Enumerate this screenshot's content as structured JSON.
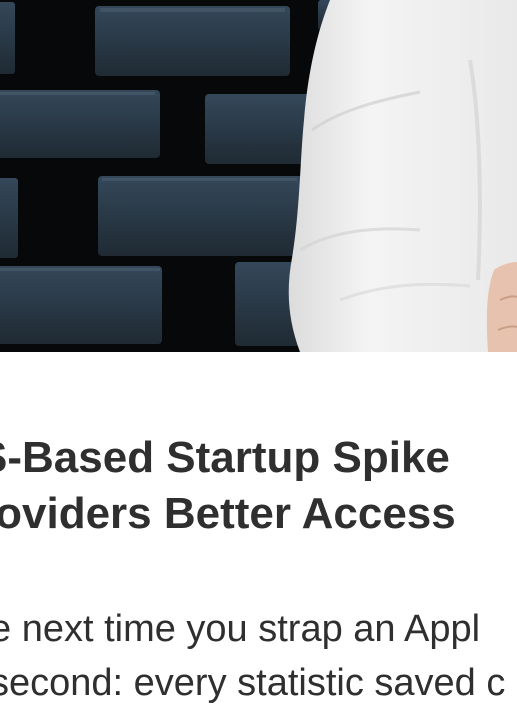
{
  "article": {
    "hero_image": {
      "description_icon": "hero-photo",
      "colors": {
        "brick": "#2b3a47",
        "mortar": "#050708",
        "sleeve": "#f1f1f1",
        "skin": "#e7c2ae"
      }
    },
    "headline_lines": [
      "S-Based Startup Spike",
      "roviders Better Access"
    ],
    "body_lines": [
      "e next time you strap an Appl",
      "second: every statistic saved c"
    ]
  }
}
